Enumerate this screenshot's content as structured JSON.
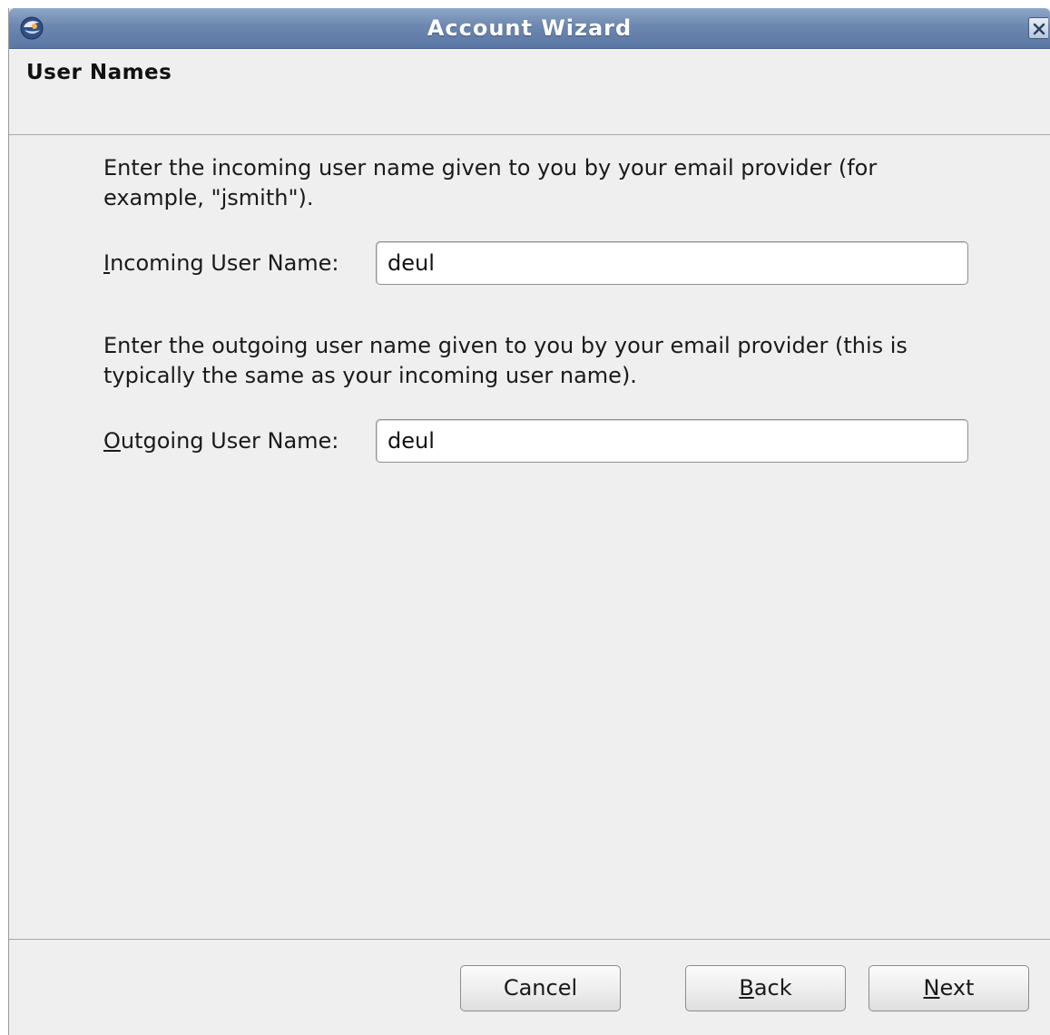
{
  "window": {
    "title": "Account Wizard"
  },
  "header": {
    "page_title": "User Names"
  },
  "incoming": {
    "description": "Enter the incoming user name given to you by your email provider (for example, \"jsmith\").",
    "label_mnemonic": "I",
    "label_rest": "ncoming User Name:",
    "value": "deul"
  },
  "outgoing": {
    "description": "Enter the outgoing user name given to you by your email provider (this is typically the same as your incoming user name).",
    "label_mnemonic": "O",
    "label_rest": "utgoing User Name:",
    "value": "deul"
  },
  "buttons": {
    "cancel": "Cancel",
    "back_mnemonic": "B",
    "back_rest": "ack",
    "next_mnemonic": "N",
    "next_rest": "ext"
  },
  "icons": {
    "app": "thunderbird-app-icon",
    "close": "close-icon"
  },
  "colors": {
    "titlebar": "#6c87b0",
    "window_bg": "#efefef"
  }
}
